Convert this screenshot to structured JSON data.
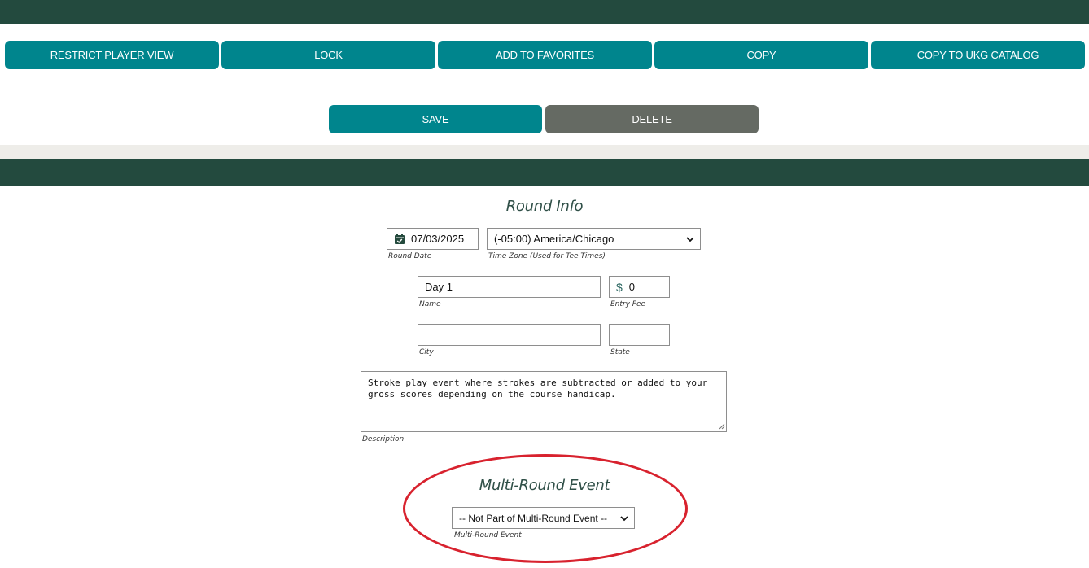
{
  "actions": {
    "restrict_player_view": "RESTRICT PLAYER VIEW",
    "lock": "LOCK",
    "add_to_favorites": "ADD TO FAVORITES",
    "copy": "COPY",
    "copy_to_ukg_catalog": "COPY TO UKG CATALOG",
    "save": "SAVE",
    "delete": "DELETE"
  },
  "round_info": {
    "title": "Round Info",
    "round_date": {
      "value": "07/03/2025",
      "label": "Round Date",
      "icon": "calendar-icon"
    },
    "time_zone": {
      "value": "(-05:00) America/Chicago",
      "label": "Time Zone (Used for Tee Times)"
    },
    "name": {
      "value": "Day 1",
      "label": "Name"
    },
    "entry_fee": {
      "currency": "$",
      "value": "0",
      "label": "Entry Fee"
    },
    "city": {
      "value": "",
      "label": "City"
    },
    "state": {
      "value": "",
      "label": "State"
    },
    "description": {
      "value": "Stroke play event where strokes are subtracted or added to your gross scores depending on the course handicap.",
      "label": "Description"
    }
  },
  "multi_round": {
    "title": "Multi-Round Event",
    "select": {
      "value": "-- Not Part of Multi-Round Event --",
      "label": "Multi-Round Event"
    }
  },
  "colors": {
    "header_green": "#234a3e",
    "button_teal": "#00858d",
    "button_gray": "#656a63",
    "annotation_red": "#d8222e"
  }
}
